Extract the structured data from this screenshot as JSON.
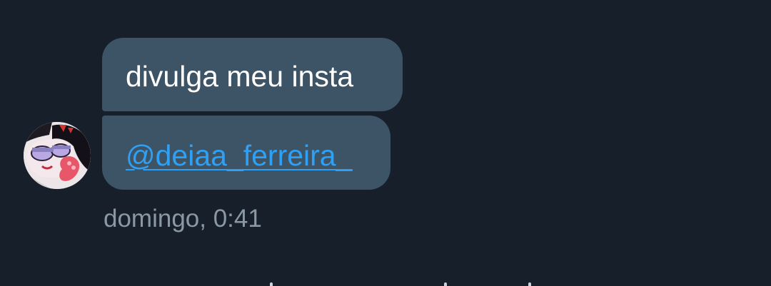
{
  "messages": [
    {
      "text": "divulga meu insta"
    },
    {
      "text": "@deiaa_ferreira_"
    }
  ],
  "timestamp": "domingo, 0:41",
  "avatar": {
    "icon": "cartoon-girl-avatar-icon"
  },
  "colors": {
    "background": "#17202a",
    "bubble": "#3d5466",
    "text": "#ffffff",
    "link": "#2ea0f5",
    "timestamp": "#8a98a6"
  }
}
